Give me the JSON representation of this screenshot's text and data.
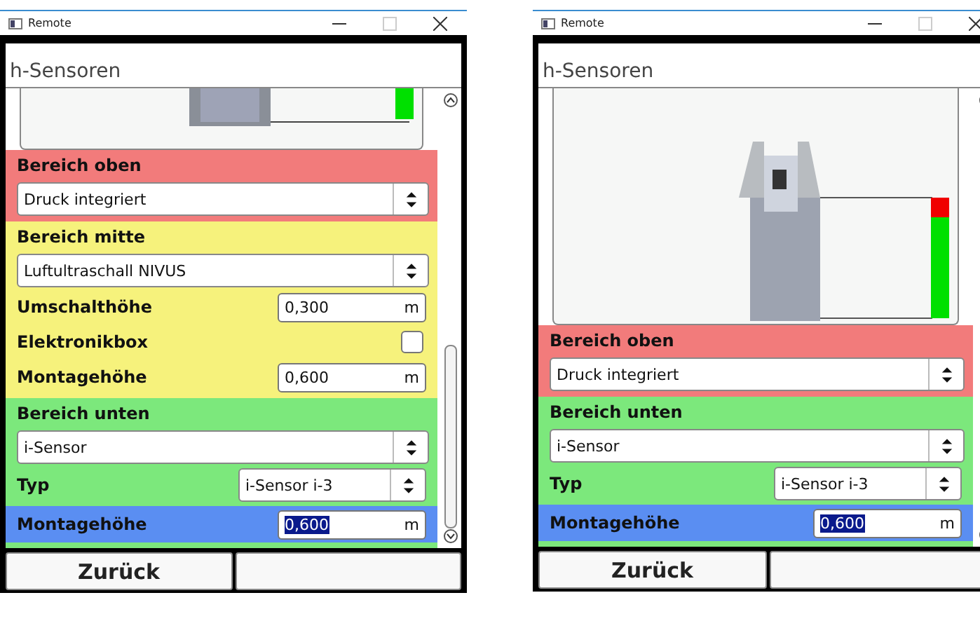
{
  "windows": [
    {
      "title": "Remote",
      "page_title": "h-Sensoren",
      "scene": {
        "kind": "partial",
        "top_marker": false
      },
      "sections": [
        {
          "color": "#f27b7b",
          "heading": "Bereich oben",
          "rows": [
            {
              "kind": "select",
              "value": "Druck integriert"
            }
          ]
        },
        {
          "color": "#f6f27c",
          "heading": "Bereich mitte",
          "rows": [
            {
              "kind": "select",
              "value": "Luftultraschall NIVUS"
            },
            {
              "kind": "input",
              "label": "Umschalthöhe",
              "value": "0,300",
              "unit": "m",
              "focused": false
            },
            {
              "kind": "checkbox",
              "label": "Elektronikbox",
              "checked": false
            },
            {
              "kind": "input",
              "label": "Montagehöhe",
              "value": "0,600",
              "unit": "m",
              "focused": false
            }
          ]
        },
        {
          "color": "#7ce87c",
          "heading": "Bereich unten",
          "rows": [
            {
              "kind": "select",
              "value": "i-Sensor"
            },
            {
              "kind": "labeled_select",
              "label": "Typ",
              "value": "i-Sensor i-3"
            },
            {
              "kind": "input",
              "label": "Montagehöhe",
              "value": "0,600",
              "unit": "m",
              "focused": true
            }
          ]
        }
      ],
      "back_button": "Zurück"
    },
    {
      "title": "Remote",
      "page_title": "h-Sensoren",
      "scene": {
        "kind": "full",
        "top_marker": true
      },
      "sections": [
        {
          "color": "#f27b7b",
          "heading": "Bereich oben",
          "rows": [
            {
              "kind": "select",
              "value": "Druck integriert"
            }
          ]
        },
        {
          "color": "#7ce87c",
          "heading": "Bereich unten",
          "rows": [
            {
              "kind": "select",
              "value": "i-Sensor"
            },
            {
              "kind": "labeled_select",
              "label": "Typ",
              "value": "i-Sensor i-3"
            },
            {
              "kind": "input",
              "label": "Montagehöhe",
              "value": "0,600",
              "unit": "m",
              "focused": true
            }
          ]
        }
      ],
      "back_button": "Zurück"
    }
  ]
}
